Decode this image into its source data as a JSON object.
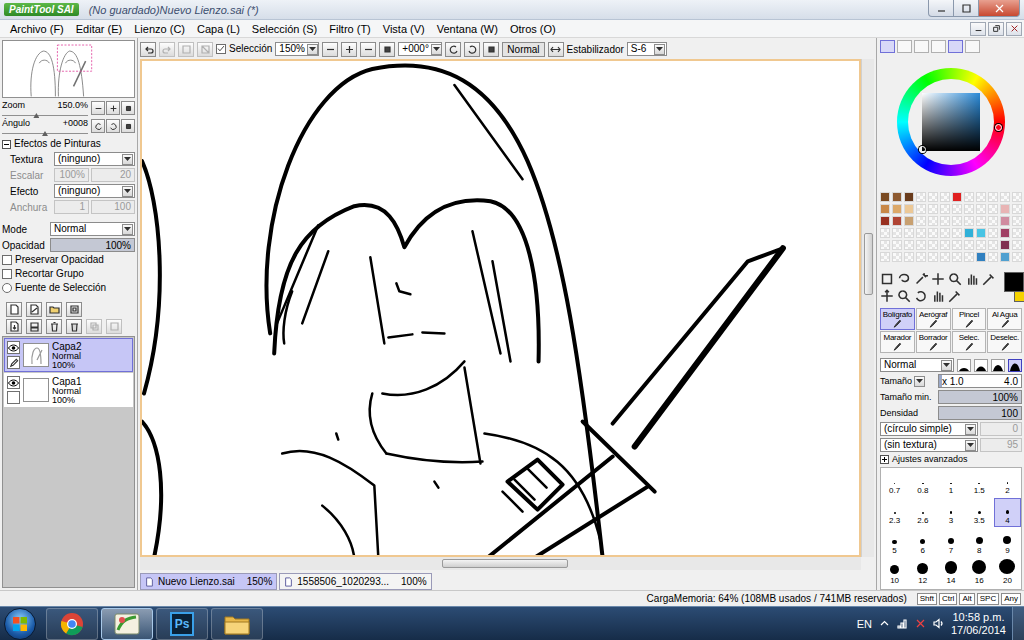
{
  "window": {
    "app": "PaintTool SAI",
    "title": "(No guardado)Nuevo Lienzo.sai (*)"
  },
  "menu": [
    "Archivo (F)",
    "Editar (E)",
    "Lienzo (C)",
    "Capa (L)",
    "Selección (S)",
    "Filtro (T)",
    "Vista (V)",
    "Ventana (W)",
    "Otros (O)"
  ],
  "navigator": {
    "zoom": {
      "label": "Zoom",
      "value": "150.0%",
      "level": 0.4
    },
    "angle": {
      "label": "Ángulo",
      "value": "+0008",
      "level": 0.5
    }
  },
  "paint_effects": {
    "title": "Efectos de Pinturas",
    "expanded": true,
    "rows": [
      {
        "kind": "select",
        "label": "Textura",
        "value": "(ninguno)",
        "disabled": false
      },
      {
        "kind": "pair",
        "label": "Escalar",
        "value": "100%",
        "extra": "20",
        "disabled": true
      },
      {
        "kind": "select",
        "label": "Efecto",
        "value": "(ninguno)",
        "disabled": false
      },
      {
        "kind": "pair",
        "label": "Anchura",
        "value": "1",
        "extra": "100",
        "disabled": true
      }
    ]
  },
  "layer_props": {
    "mode": {
      "label": "Mode",
      "value": "Normal"
    },
    "opacity": {
      "label": "Opacidad",
      "value": "100%",
      "level": 1
    },
    "options": [
      {
        "kind": "checkbox",
        "label": "Preservar Opacidad",
        "checked": false
      },
      {
        "kind": "checkbox",
        "label": "Recortar Grupo",
        "checked": false
      },
      {
        "kind": "radio",
        "label": "Fuente de Selección",
        "checked": false
      }
    ]
  },
  "layers": [
    {
      "name": "Capa2",
      "mode": "Normal",
      "opacity": "100%",
      "visible": true,
      "selected": true
    },
    {
      "name": "Capa1",
      "mode": "Normal",
      "opacity": "100%",
      "visible": true,
      "selected": false
    }
  ],
  "toolbar": {
    "selection": {
      "label": "Selección",
      "checked": true
    },
    "zoom": "150%",
    "angle": "+000°",
    "blend": "Normal",
    "stabilizer": {
      "label": "Estabilizador",
      "value": "S-6"
    }
  },
  "canvas_tabs": [
    {
      "label": "Nuevo Lienzo.sai",
      "zoom": "150%",
      "selected": true
    },
    {
      "label": "1558506_1020293...",
      "zoom": "100%",
      "selected": false
    }
  ],
  "colors": {
    "primary": "#000000",
    "secondary": "#f5d200",
    "swatches": [
      [
        "#7a4a22",
        "#8e5a30",
        "#6a3c1c",
        "",
        "",
        "",
        "#e02020",
        "",
        "",
        "",
        "",
        ""
      ],
      [
        "#c88848",
        "#dca868",
        "#ecc896",
        "",
        "",
        "",
        "",
        "",
        "",
        "",
        "#e8b4b4",
        ""
      ],
      [
        "#983020",
        "#b04434",
        "#c8a070",
        "",
        "",
        "",
        "",
        "",
        "",
        "",
        "#d08ca0",
        ""
      ],
      [
        "",
        "",
        "",
        "",
        "",
        "",
        "",
        "#30b0d8",
        "#48c4e4",
        "",
        "#a04064",
        ""
      ],
      [
        "",
        "",
        "",
        "",
        "",
        "",
        "",
        "",
        "",
        "",
        "#803050",
        ""
      ],
      [
        "",
        "",
        "",
        "",
        "",
        "",
        "",
        "",
        "#3080c0",
        "",
        "#50a0d0",
        ""
      ]
    ]
  },
  "tools": [
    {
      "label": "Bolígrafo",
      "selected": true
    },
    {
      "label": "Aerógraf",
      "selected": false
    },
    {
      "label": "Pincel",
      "selected": false
    },
    {
      "label": "Al Agua",
      "selected": false
    },
    {
      "label": "Marador",
      "selected": false
    },
    {
      "label": "Borrador",
      "selected": false
    },
    {
      "label": "Selec.",
      "selected": false
    },
    {
      "label": "Deselec.",
      "selected": false
    }
  ],
  "brush": {
    "mode": "Normal",
    "tips": [
      {
        "selected": false
      },
      {
        "selected": false
      },
      {
        "selected": false
      },
      {
        "selected": true
      }
    ],
    "size": {
      "label": "Tamaño",
      "scale": "x 1.0",
      "value": "4.0",
      "level": 0.04
    },
    "min_size": {
      "label": "Tamaño min.",
      "value": "100%",
      "level": 1
    },
    "density": {
      "label": "Densidad",
      "value": "100",
      "level": 1
    },
    "shape": {
      "value": "(círculo simple)",
      "amount": "0",
      "disabled": true
    },
    "texture": {
      "value": "(sin textura)",
      "amount": "95",
      "disabled": true
    },
    "advanced": {
      "label": "Ajustes avanzados",
      "expanded": false
    },
    "sizes": [
      {
        "value": "0.7",
        "selected": false
      },
      {
        "value": "0.8",
        "selected": false
      },
      {
        "value": "1",
        "selected": false
      },
      {
        "value": "1.5",
        "selected": false
      },
      {
        "value": "2",
        "selected": false
      },
      {
        "value": "2.3",
        "selected": false
      },
      {
        "value": "2.6",
        "selected": false
      },
      {
        "value": "3",
        "selected": false
      },
      {
        "value": "3.5",
        "selected": false
      },
      {
        "value": "4",
        "selected": true
      },
      {
        "value": "5",
        "selected": false
      },
      {
        "value": "6",
        "selected": false
      },
      {
        "value": "7",
        "selected": false
      },
      {
        "value": "8",
        "selected": false
      },
      {
        "value": "9",
        "selected": false
      },
      {
        "value": "10",
        "selected": false
      },
      {
        "value": "12",
        "selected": false
      },
      {
        "value": "14",
        "selected": false
      },
      {
        "value": "16",
        "selected": false
      },
      {
        "value": "20",
        "selected": false
      }
    ]
  },
  "status_bar": {
    "memory": "CargaMemoria: 64% (108MB usados / 741MB reservados)",
    "keys": [
      "Shft",
      "Ctrl",
      "Alt",
      "SPC",
      "Any"
    ]
  },
  "taskbar": {
    "apps": [
      {
        "kind": "chrome",
        "label": "",
        "active": false
      },
      {
        "kind": "sai",
        "label": "",
        "active": true
      },
      {
        "kind": "photoshop",
        "label": "Ps",
        "active": false
      },
      {
        "kind": "folder",
        "label": "",
        "active": false
      }
    ],
    "language": "EN",
    "time": "10:58 p.m.",
    "date": "17/06/2014"
  }
}
